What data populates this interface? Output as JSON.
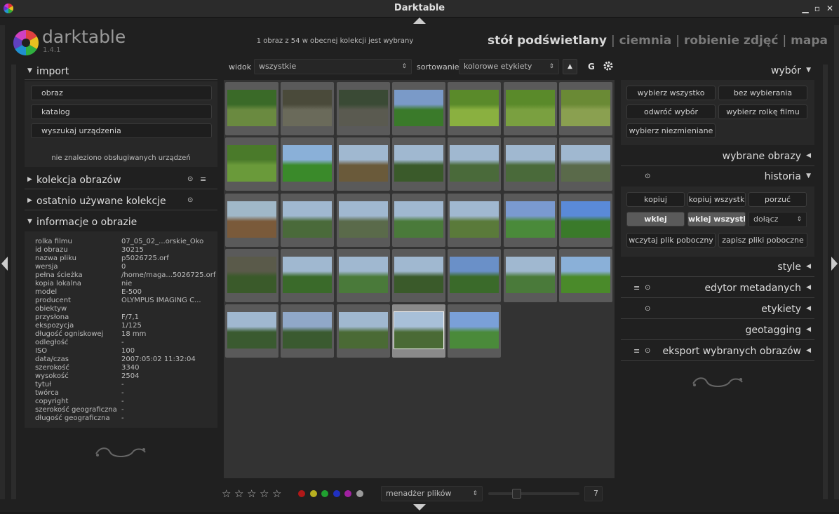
{
  "window": {
    "title": "Darktable"
  },
  "header": {
    "brand": "darktable",
    "version": "1.4.1",
    "status": "1 obraz z 54 w obecnej kolekcji jest wybrany",
    "views": [
      "stół podświetlany",
      "ciemnia",
      "robienie zdjęć",
      "mapa"
    ],
    "separator": "|"
  },
  "left": {
    "import": {
      "title": "import",
      "buttons": [
        "obraz",
        "katalog",
        "wyszukaj urządzenia"
      ],
      "note": "nie znaleziono obsługiwanych urządzeń"
    },
    "collections": {
      "title": "kolekcja obrazów"
    },
    "recent": {
      "title": "ostatnio używane kolekcje"
    },
    "info": {
      "title": "informacje o obrazie",
      "rows": [
        [
          "rolka filmu",
          "07_05_02_...orskie_Oko"
        ],
        [
          "id obrazu",
          "30215"
        ],
        [
          "nazwa pliku",
          "p5026725.orf"
        ],
        [
          "wersja",
          "0"
        ],
        [
          "pełna ścieżka",
          "/home/maga...5026725.orf"
        ],
        [
          "kopia lokalna",
          "nie"
        ],
        [
          "model",
          "E-500"
        ],
        [
          "producent",
          "OLYMPUS IMAGING C..."
        ],
        [
          "obiektyw",
          ""
        ],
        [
          "przysłona",
          "F/7,1"
        ],
        [
          "ekspozycja",
          "1/125"
        ],
        [
          "długość ogniskowej",
          "18 mm"
        ],
        [
          "odległość",
          "-"
        ],
        [
          "ISO",
          "100"
        ],
        [
          "data/czas",
          "2007:05:02 11:32:04"
        ],
        [
          "szerokość",
          "3340"
        ],
        [
          "wysokość",
          "2504"
        ],
        [
          "tytuł",
          "-"
        ],
        [
          "twórca",
          "-"
        ],
        [
          "copyright",
          "-"
        ],
        [
          "szerokość geograficzna",
          "-"
        ],
        [
          "długość geograficzna",
          "-"
        ]
      ]
    }
  },
  "toolbar": {
    "view_label": "widok",
    "view_value": "wszystkie",
    "sort_label": "sortowanie",
    "sort_value": "kolorowe etykiety",
    "group_label": "G"
  },
  "thumbs": [
    {
      "colors": [
        "#3a6a28",
        "#6a8a40"
      ]
    },
    {
      "colors": [
        "#4a4a3a",
        "#6a6a5a"
      ]
    },
    {
      "colors": [
        "#3a4a35",
        "#5a5a50"
      ]
    },
    {
      "colors": [
        "#7a9ac8",
        "#3a7a2a"
      ]
    },
    {
      "colors": [
        "#5a8a2a",
        "#8ab040"
      ]
    },
    {
      "colors": [
        "#5a8a2a",
        "#7aa040"
      ]
    },
    {
      "colors": [
        "#6a8a35",
        "#8aa050"
      ]
    },
    {
      "colors": [
        "#4a7a2a",
        "#6a9a3a"
      ]
    },
    {
      "colors": [
        "#8ab0d8",
        "#3a8a2a"
      ]
    },
    {
      "colors": [
        "#a0b8d0",
        "#6a5a3a"
      ]
    },
    {
      "colors": [
        "#a0b8d0",
        "#3a5a2a"
      ]
    },
    {
      "colors": [
        "#a0b8d0",
        "#4a6a3a"
      ]
    },
    {
      "colors": [
        "#a0b8d0",
        "#4a6a3a"
      ]
    },
    {
      "colors": [
        "#a0b8d0",
        "#5a6a4a"
      ]
    },
    {
      "colors": [
        "#a0b8c8",
        "#7a5a3a"
      ]
    },
    {
      "colors": [
        "#a0b8d0",
        "#4a6a3a"
      ]
    },
    {
      "colors": [
        "#a0b8d0",
        "#5a6a4a"
      ]
    },
    {
      "colors": [
        "#a0b8d0",
        "#4a7a3a"
      ]
    },
    {
      "colors": [
        "#a0b8d0",
        "#5a7a3a"
      ]
    },
    {
      "colors": [
        "#7a9ad0",
        "#4a8a3a"
      ]
    },
    {
      "colors": [
        "#5a8ad8",
        "#3a7a2a"
      ]
    },
    {
      "colors": [
        "#5a5a4a",
        "#3a5a2a"
      ]
    },
    {
      "colors": [
        "#a0b8d0",
        "#3a6a2a"
      ]
    },
    {
      "colors": [
        "#a0b8d0",
        "#4a7a3a"
      ]
    },
    {
      "colors": [
        "#a0b8d0",
        "#3a5a2a"
      ]
    },
    {
      "colors": [
        "#6a90c8",
        "#3a6a2a"
      ]
    },
    {
      "colors": [
        "#a0b8d0",
        "#4a7a3a"
      ]
    },
    {
      "colors": [
        "#8ab0d8",
        "#4a8a2a"
      ]
    },
    {
      "colors": [
        "#a0b8d0",
        "#3a5a30"
      ]
    },
    {
      "colors": [
        "#90a8c8",
        "#3a5a30"
      ]
    },
    {
      "colors": [
        "#a0b8d0",
        "#4a6a35"
      ]
    },
    {
      "colors": [
        "#a8c0d8",
        "#4a6a35"
      ],
      "selected": true
    },
    {
      "colors": [
        "#7aa0d8",
        "#4a8a3a"
      ]
    }
  ],
  "bottom": {
    "stars": [
      "☆",
      "☆",
      "☆",
      "☆",
      "☆"
    ],
    "color_labels": [
      "#b01818",
      "#b8b020",
      "#20a030",
      "#2030c0",
      "#a020a0",
      "#9a9a9a"
    ],
    "filmstrip_mode": "menadżer plików",
    "zoom": "7"
  },
  "right": {
    "select": {
      "title": "wybór",
      "buttons": [
        "wybierz wszystko",
        "bez wybierania",
        "odwróć wybór",
        "wybierz rolkę filmu",
        "wybierz niezmieniane"
      ]
    },
    "selected_images": {
      "title": "wybrane obrazy"
    },
    "history": {
      "title": "historia",
      "buttons": [
        "kopiuj",
        "kopiuj wszystk",
        "porzuć",
        "wklej",
        "wklej wszystko",
        "wczytaj plik poboczny",
        "zapisz pliki poboczne"
      ],
      "mode_value": "dołącz"
    },
    "sections": [
      "style",
      "edytor metadanych",
      "etykiety",
      "geotagging",
      "eksport wybranych obrazów"
    ]
  }
}
